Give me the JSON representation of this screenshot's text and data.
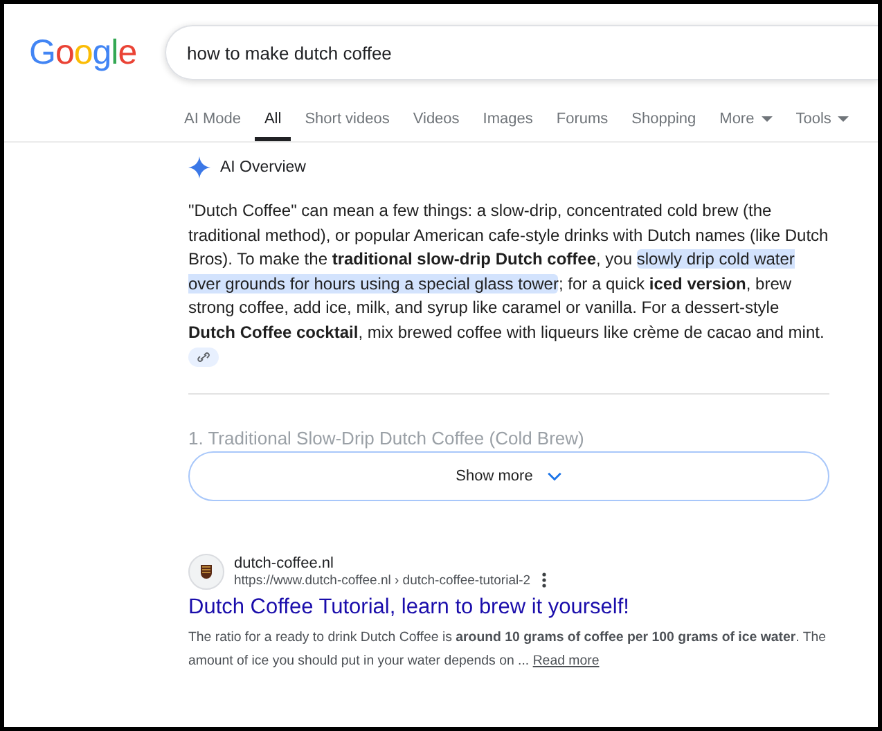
{
  "logo": "Google",
  "search": {
    "value": "how to make dutch coffee"
  },
  "tabs": [
    {
      "label": "AI Mode",
      "selected": false,
      "dropdown": false
    },
    {
      "label": "All",
      "selected": true,
      "dropdown": false
    },
    {
      "label": "Short videos",
      "selected": false,
      "dropdown": false
    },
    {
      "label": "Videos",
      "selected": false,
      "dropdown": false
    },
    {
      "label": "Images",
      "selected": false,
      "dropdown": false
    },
    {
      "label": "Forums",
      "selected": false,
      "dropdown": false
    },
    {
      "label": "Shopping",
      "selected": false,
      "dropdown": false
    },
    {
      "label": "More",
      "selected": false,
      "dropdown": true
    },
    {
      "label": "Tools",
      "selected": false,
      "dropdown": true
    }
  ],
  "ai_overview": {
    "title": "AI Overview",
    "paragraph": [
      {
        "text": "\"Dutch Coffee\" can mean a few things: a slow-drip, concentrated cold brew (the traditional method), or popular American cafe-style drinks with Dutch names (like Dutch Bros). To make the ",
        "bold": false,
        "highlighted": false
      },
      {
        "text": "traditional slow-drip Dutch coffee",
        "bold": true,
        "highlighted": false
      },
      {
        "text": ", you ",
        "bold": false,
        "highlighted": false
      },
      {
        "text": "slowly drip cold water over grounds for hours using a special glass tower",
        "bold": false,
        "highlighted": true
      },
      {
        "text": "; for a quick ",
        "bold": false,
        "highlighted": false
      },
      {
        "text": "iced version",
        "bold": true,
        "highlighted": false
      },
      {
        "text": ", brew strong coffee, add ice, milk, and syrup like caramel or vanilla. For a dessert-style ",
        "bold": false,
        "highlighted": false
      },
      {
        "text": "Dutch Coffee cocktail",
        "bold": true,
        "highlighted": false
      },
      {
        "text": ", mix brewed coffee with liqueurs like crème de cacao and mint.",
        "bold": false,
        "highlighted": false
      }
    ],
    "faded_heading": "1. Traditional Slow-Drip Dutch Coffee (Cold Brew)",
    "show_more": "Show more"
  },
  "result": {
    "site": "dutch-coffee.nl",
    "url": "https://www.dutch-coffee.nl › dutch-coffee-tutorial-2",
    "title": "Dutch Coffee Tutorial, learn to brew it yourself!",
    "snippet": "The ratio for a ready to drink Dutch Coffee is **around 10 grams of coffee per 100 grams of ice water**. The amount of ice you should put in your water depends on ...",
    "read_more": "Read more"
  }
}
